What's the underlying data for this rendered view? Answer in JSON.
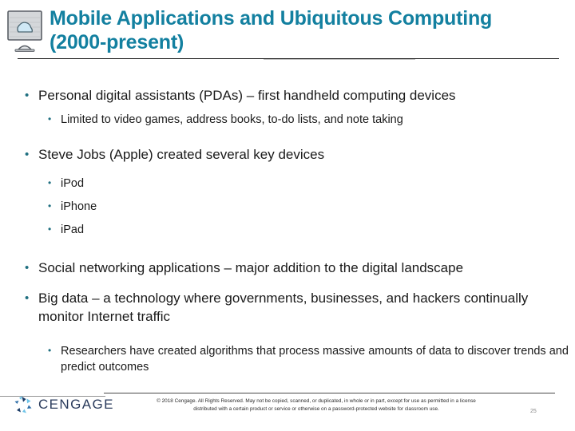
{
  "slide": {
    "title": "Mobile Applications and Ubiquitous Computing (2000-present)",
    "title_color": "#1380a0",
    "body_color": "#1a1a1a",
    "bullet_color": "#1f6f80",
    "header_icon": "cloud-monitor-icon",
    "bullets": [
      {
        "level": 1,
        "text": "Personal digital assistants (PDAs) – first handheld computing devices",
        "marker": "•"
      },
      {
        "level": 2,
        "text": "Limited to video games, address books, to-do lists, and note taking",
        "marker": "•"
      },
      {
        "level": 1,
        "text": "Steve Jobs (Apple) created several key devices",
        "marker": "•"
      },
      {
        "level": 2,
        "text": "iPod",
        "marker": "•"
      },
      {
        "level": 2,
        "text": "iPhone",
        "marker": "•"
      },
      {
        "level": 2,
        "text": "iPad",
        "marker": "•"
      },
      {
        "level": 1,
        "text": "Social networking applications – major addition to the digital landscape",
        "marker": "•"
      },
      {
        "level": 1,
        "text": "Big data – a technology where governments, businesses, and hackers continually monitor Internet traffic",
        "marker": "•"
      },
      {
        "level": 2,
        "text": "Researchers have created algorithms that process massive amounts of data to discover trends and predict outcomes",
        "marker": "•"
      }
    ]
  },
  "footer": {
    "logo_text": "CENGAGE",
    "logo_mark": "cengage-pinwheel-icon",
    "copyright_line1": "© 2018 Cengage. All Rights Reserved. May not be copied, scanned, or duplicated, in whole or in part, except for use as permitted in a license",
    "copyright_line2": "distributed with a certain product or service or otherwise on a password-protected website for classroom use.",
    "page_number": "25"
  }
}
